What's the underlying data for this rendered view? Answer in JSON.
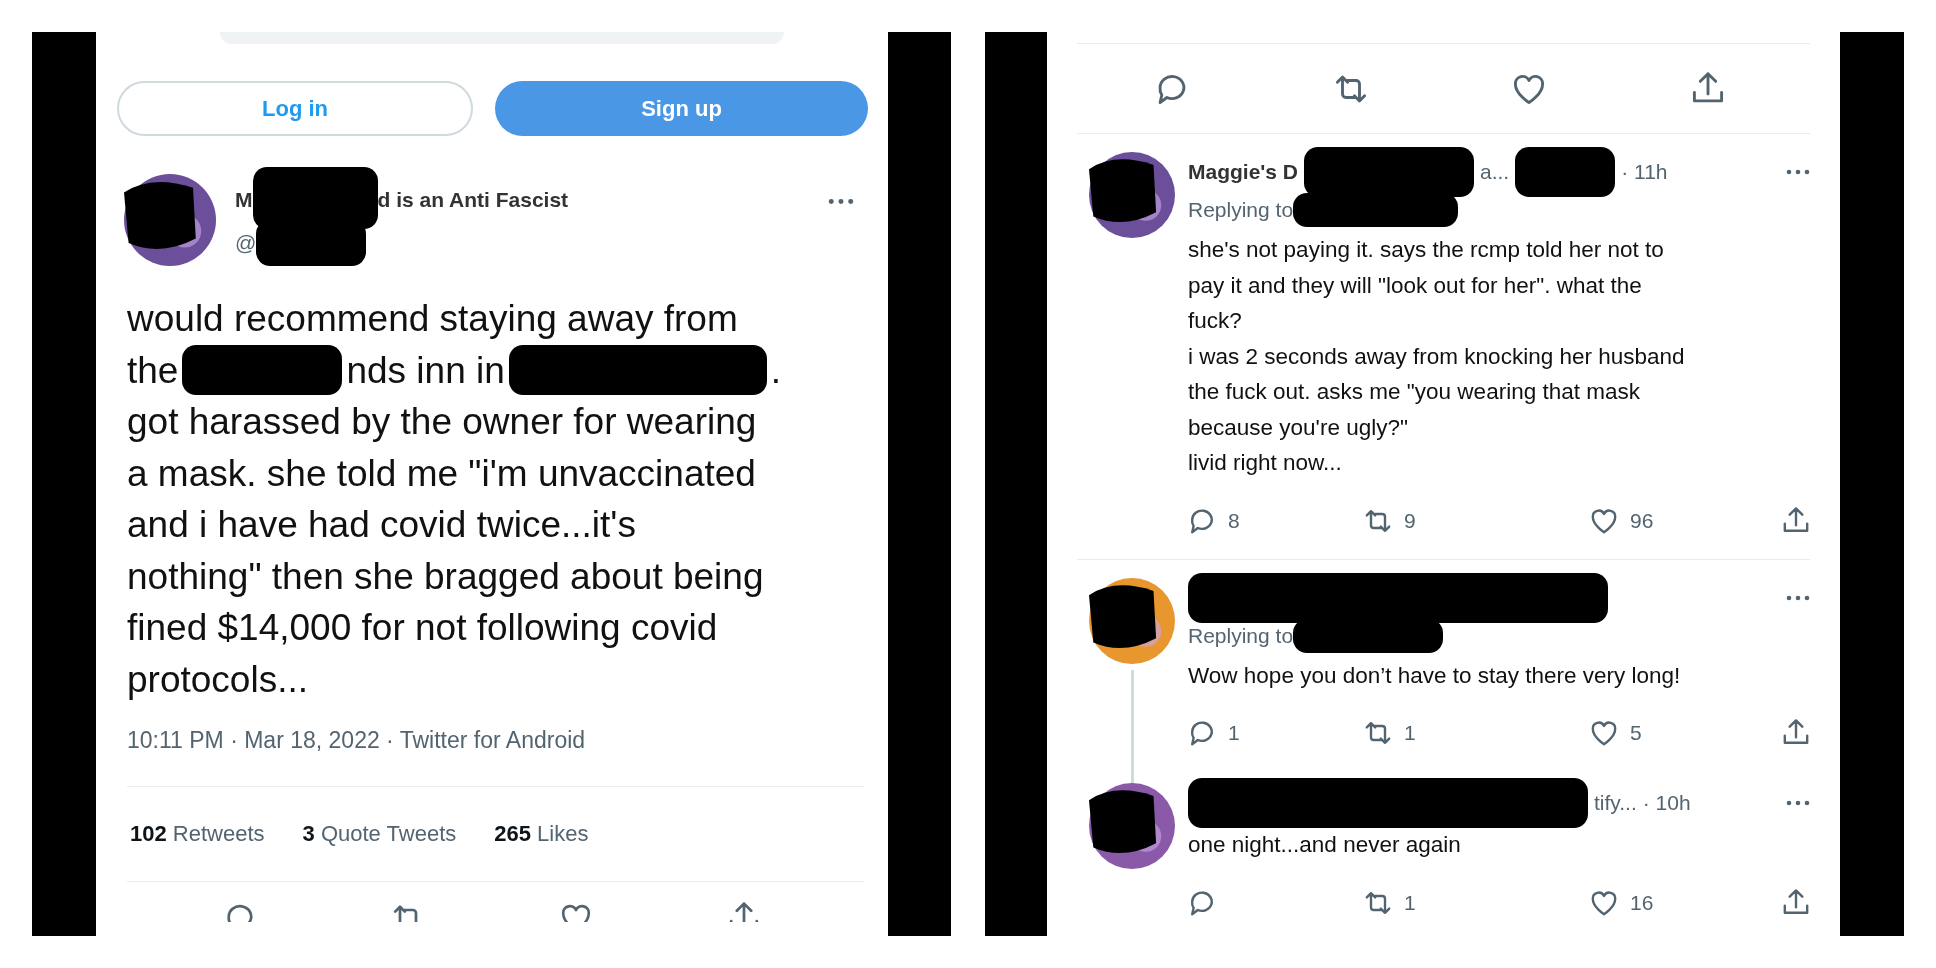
{
  "tweet": {
    "buttons": [
      {
        "label": "Log in",
        "kind": "outline"
      },
      {
        "label": "Sign up",
        "kind": "filled"
      }
    ],
    "author": {
      "avatar": {
        "color": "#6b4f9a"
      },
      "name": [
        {
          "text": "M"
        },
        {
          "kind": "redacted"
        },
        {
          "text": "d is an Anti Fascist"
        }
      ],
      "handle": [
        {
          "text": "@"
        },
        {
          "kind": "redacted"
        }
      ]
    },
    "lines": [
      [
        {
          "text": "would recommend staying away from"
        }
      ],
      [
        {
          "text": "the"
        },
        {
          "kind": "redacted"
        },
        {
          "text": "nds inn in"
        },
        {
          "kind": "redacted"
        },
        {
          "text": "."
        }
      ],
      [
        {
          "text": "got harassed by the owner for wearing"
        }
      ],
      [
        {
          "text": "a mask. she told me \"i'm unvaccinated"
        }
      ],
      [
        {
          "text": "and i have had covid twice...it's"
        }
      ],
      [
        {
          "text": "nothing\" then she bragged about being"
        }
      ],
      [
        {
          "text": "fined $14,000 for not following covid"
        }
      ],
      [
        {
          "text": "protocols..."
        }
      ]
    ],
    "meta": "10:11 PM · Mar 18, 2022 · Twitter for Android",
    "stats": [
      {
        "count": "102",
        "label": "Retweets"
      },
      {
        "count": "3",
        "label": "Quote Tweets"
      },
      {
        "count": "265",
        "label": "Likes"
      }
    ]
  },
  "thread": {
    "actions": [
      {
        "kind": "reply"
      },
      {
        "kind": "retweet"
      },
      {
        "kind": "like"
      },
      {
        "kind": "share"
      }
    ],
    "replies": [
      {
        "avatar": {
          "color": "#6b4f9a"
        },
        "connected": false,
        "name": [
          {
            "text": "Maggie's D"
          },
          {
            "kind": "redacted"
          },
          {
            "text": "a..."
          },
          {
            "kind": "redacted"
          },
          {
            "text": "· 11h"
          }
        ],
        "replying": [
          {
            "text": "Replying to"
          },
          {
            "kind": "redacted"
          }
        ],
        "lines": [
          "she's not paying it. says the rcmp told her not to",
          "pay it and they will \"look out for her\". what the",
          "fuck?",
          "i was 2 seconds away from knocking her husband",
          "the fuck out. asks me \"you wearing that mask",
          "because you're ugly?\"",
          "livid right now..."
        ],
        "stats": [
          {
            "kind": "reply",
            "count": "8"
          },
          {
            "kind": "retweet",
            "count": "9"
          },
          {
            "kind": "like",
            "count": "96"
          },
          {
            "kind": "share"
          }
        ]
      },
      {
        "avatar": {
          "color": "#e8962e"
        },
        "connected": true,
        "name": [
          {
            "kind": "redacted"
          }
        ],
        "replying": [
          {
            "text": "Replying to"
          },
          {
            "kind": "redacted"
          }
        ],
        "lines": [
          "Wow hope you don’t have to stay there very long!"
        ],
        "stats": [
          {
            "kind": "reply",
            "count": "1"
          },
          {
            "kind": "retweet",
            "count": "1"
          },
          {
            "kind": "like",
            "count": "5"
          },
          {
            "kind": "share"
          }
        ]
      },
      {
        "avatar": {
          "color": "#8a5aa8"
        },
        "connected": false,
        "name": [
          {
            "kind": "redacted"
          },
          {
            "text": "tify..."
          },
          {
            "text": "· 10h"
          }
        ],
        "lines": [
          "one night...and never again"
        ],
        "stats": [
          {
            "kind": "reply"
          },
          {
            "kind": "retweet",
            "count": "1"
          },
          {
            "kind": "like",
            "count": "16"
          },
          {
            "kind": "share"
          }
        ]
      }
    ]
  }
}
